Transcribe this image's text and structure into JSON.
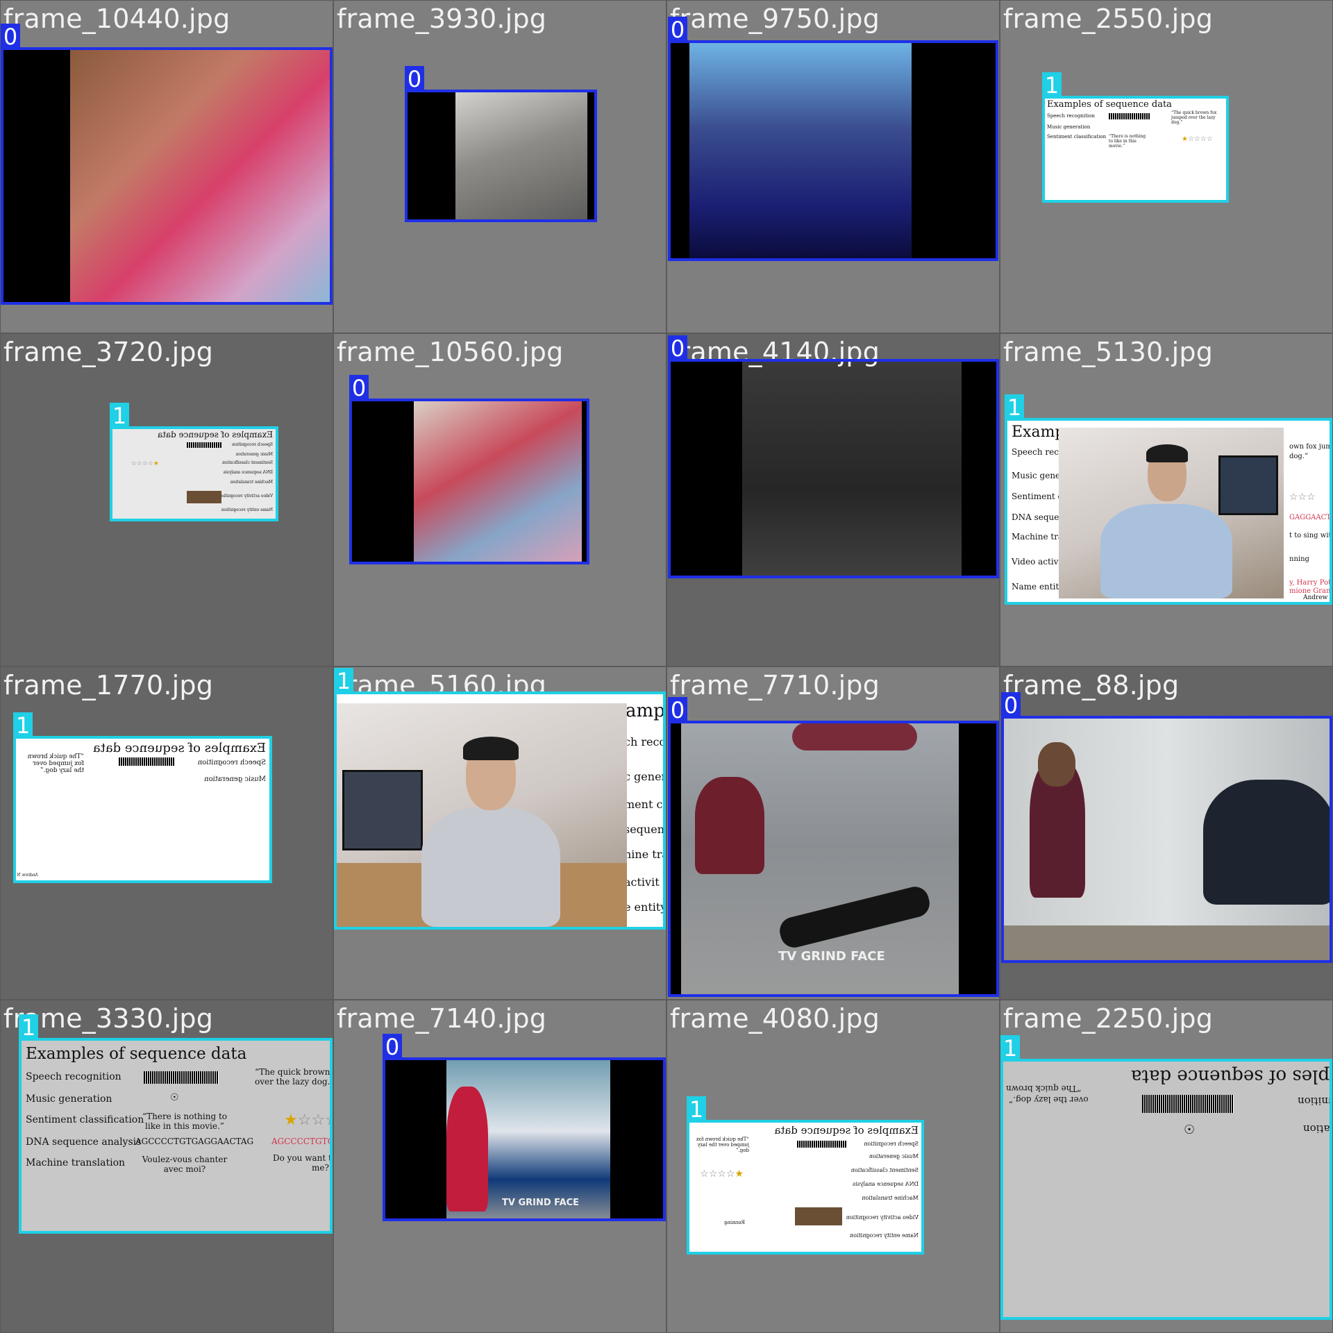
{
  "tiles": [
    {
      "filename": "frame_10440.jpg",
      "class_label": "0"
    },
    {
      "filename": "frame_3930.jpg",
      "class_label": "0"
    },
    {
      "filename": "frame_9750.jpg",
      "class_label": "0"
    },
    {
      "filename": "frame_2550.jpg",
      "class_label": "1"
    },
    {
      "filename": "frame_3720.jpg",
      "class_label": "1"
    },
    {
      "filename": "frame_10560.jpg",
      "class_label": "0"
    },
    {
      "filename": "frame_4140.jpg",
      "class_label": "0"
    },
    {
      "filename": "frame_5130.jpg",
      "class_label": "1"
    },
    {
      "filename": "frame_1770.jpg",
      "class_label": "1"
    },
    {
      "filename": "frame_5160.jpg",
      "class_label": "1"
    },
    {
      "filename": "frame_7710.jpg",
      "class_label": "0"
    },
    {
      "filename": "frame_88.jpg",
      "class_label": "0"
    },
    {
      "filename": "frame_3330.jpg",
      "class_label": "1"
    },
    {
      "filename": "frame_7140.jpg",
      "class_label": "0"
    },
    {
      "filename": "frame_4080.jpg",
      "class_label": "1"
    },
    {
      "filename": "frame_2250.jpg",
      "class_label": "1"
    }
  ],
  "slide": {
    "title": "Examples of sequence data",
    "rows": [
      "Speech recognition",
      "Music generation",
      "Sentiment classification",
      "DNA sequence analysis",
      "Machine translation",
      "Video activity recognition",
      "Name entity recognition"
    ],
    "outputs": {
      "speech": "“The quick brown fox jumped over the lazy dog.”",
      "sentiment_in": "“There is nothing to like in this movie.”",
      "dna_in": "AGCCCCTGTGAGGAACTAG",
      "dna_out": "AGCCCCTGTGAGGAACTAG",
      "translation_in": "Voulez-vous chanter avec moi?",
      "translation_out": "Do you want to sing with me?",
      "video_out": "Running",
      "ner_in": "Yesterday, Harry Potter met Hermione Granger.",
      "ner_out": "Yesterday, Harry Potter met Hermione Granger."
    },
    "crop_labels": {
      "speech": "Speech recog",
      "music": "Music gener",
      "sentiment": "Sentiment c",
      "dna": "DNA sequer",
      "translation": "Machine tra",
      "video": "Video activi",
      "ner": "Name entity",
      "title_part": "Examp",
      "right_fox": "own fox jumpe",
      "right_dog": "dog.”",
      "right_dna": "GAGGAACTA",
      "right_sing": "t to sing with",
      "right_running": "nning",
      "right_harry": "y, Harry Potte",
      "right_herm": "mione Grange",
      "author": "Andrew N",
      "ample": "amp",
      "rev_speech": "ch recog",
      "rev_gener": "c gener",
      "rev_ment": "ment c",
      "rev_seque": "sequen",
      "rev_ine": "nine tra",
      "rev_activ": "activit",
      "rev_entity": "e entity",
      "wm": "GRIND FACE",
      "wm_tv": "TV",
      "quick_left": "“The quick brown",
      "lazy_left": "over the lazy dog.”",
      "ples": "ples of sequence data",
      "gnition": "gnition",
      "ration": "ration",
      "quick_brown_f": "“The quick brown f",
      "over_lazy": "over the lazy dog.”",
      "do_you_want": "Do you want to si",
      "me": "me?",
      "ag_partial": "AGCCCCTGTGAGG"
    }
  },
  "colors": {
    "class0": "#1f2fe6",
    "class1": "#1fd0e6"
  },
  "icons": {
    "stars": "★☆☆☆☆",
    "rotation": "☉"
  }
}
